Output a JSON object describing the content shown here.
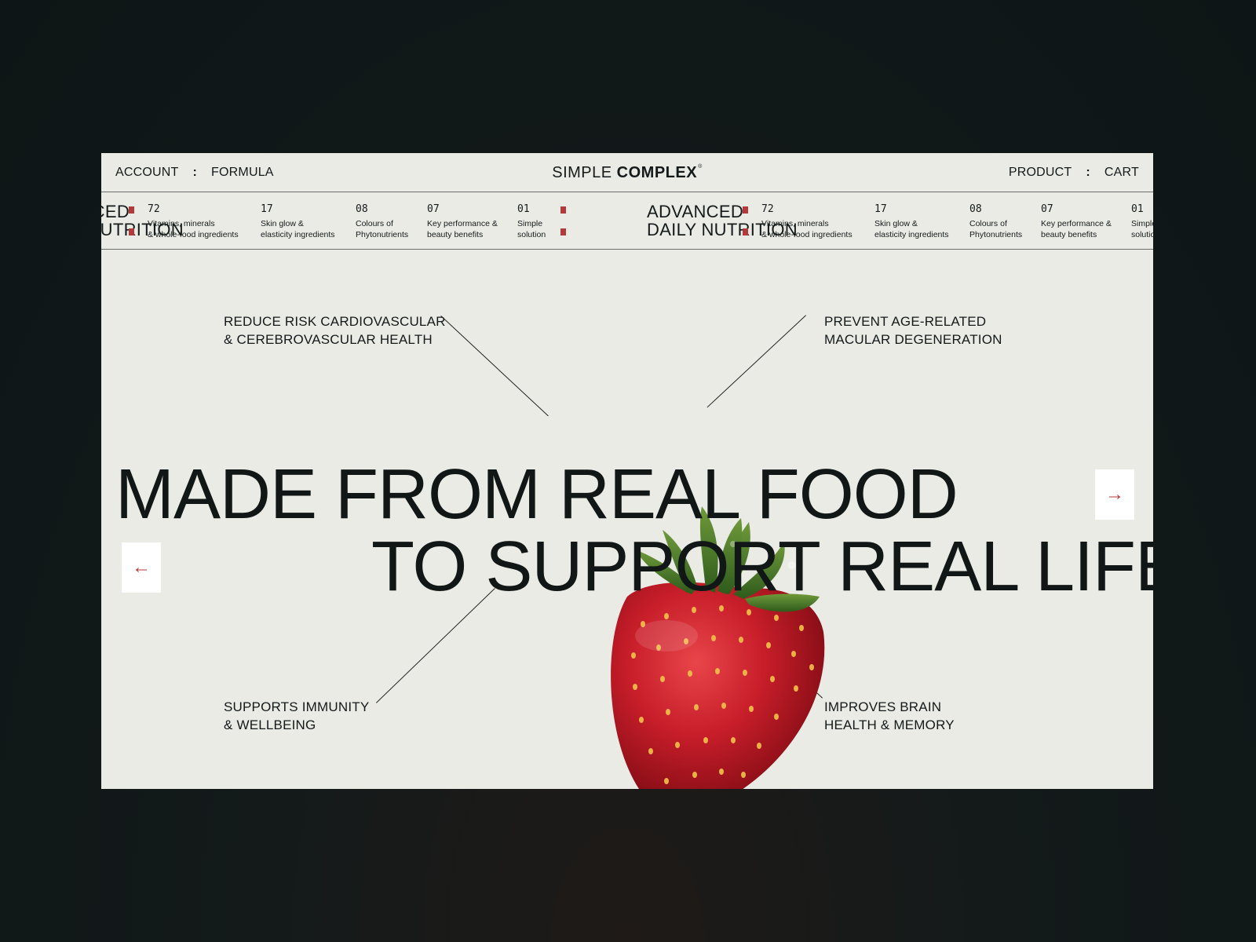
{
  "nav": {
    "account": "ACCOUNT",
    "formula": "FORMULA",
    "separator": ":",
    "product": "PRODUCT",
    "cart": "CART",
    "logo_a": "SIMPLE",
    "logo_b": "COMPLEX",
    "logo_reg": "®"
  },
  "ticker": {
    "title_line1": "ADVANCED",
    "title_line2": "DAILY NUTRITION",
    "stats": [
      {
        "num": "72",
        "desc": "Vitamins, minerals\n& whole-food ingredients"
      },
      {
        "num": "17",
        "desc": "Skin glow &\nelasticity ingredients"
      },
      {
        "num": "08",
        "desc": "Colours of\nPhytonutrients"
      },
      {
        "num": "07",
        "desc": "Key performance &\nbeauty benefits"
      },
      {
        "num": "01",
        "desc": "Simple\nsolution"
      }
    ],
    "accent_color": "#b23a3a"
  },
  "benefits": {
    "top_left": "REDUCE RISK CARDIOVASCULAR\n& CEREBROVASCULAR HEALTH",
    "top_right": "PREVENT AGE-RELATED\nMACULAR DEGENERATION",
    "bottom_left": "SUPPORTS IMMUNITY\n& WELLBEING",
    "bottom_right": "IMPROVES BRAIN\nHEALTH & MEMORY"
  },
  "hero": {
    "line1": "MADE FROM REAL FOOD",
    "line2": "TO SUPPORT REAL LIFE",
    "image": "strawberry"
  },
  "controls": {
    "prev_icon": "arrow-left-icon",
    "next_icon": "arrow-right-icon",
    "prev_glyph": "←",
    "next_glyph": "→"
  }
}
